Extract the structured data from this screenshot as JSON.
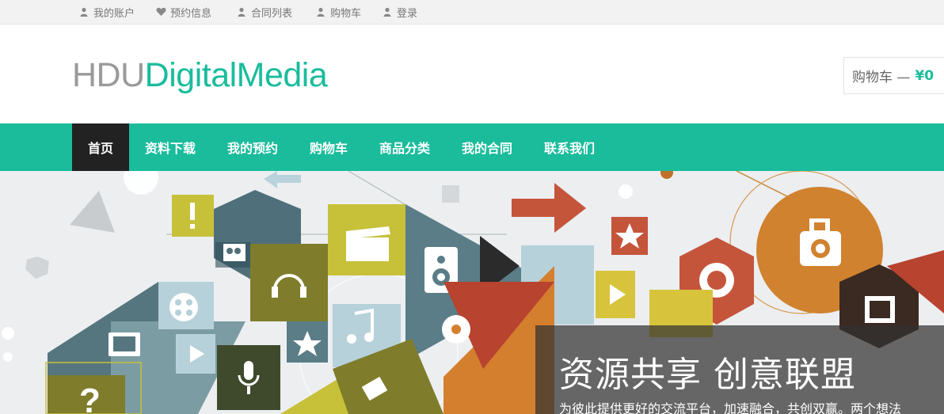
{
  "topbar": {
    "items": [
      {
        "label": "我的账户",
        "icon": "user-icon"
      },
      {
        "label": "预约信息",
        "icon": "heart-icon"
      },
      {
        "label": "合同列表",
        "icon": "user-icon"
      },
      {
        "label": "购物车",
        "icon": "user-icon"
      },
      {
        "label": "登录",
        "icon": "user-icon"
      }
    ]
  },
  "header": {
    "logo_part1": "HDU",
    "logo_part2": "DigitalMedia",
    "cart_label": "购物车 —",
    "cart_price": "¥0"
  },
  "nav": {
    "tabs": [
      {
        "label": "首页",
        "active": true
      },
      {
        "label": "资料下载"
      },
      {
        "label": "我的预约"
      },
      {
        "label": "购物车"
      },
      {
        "label": "商品分类"
      },
      {
        "label": "我的合同"
      },
      {
        "label": "联系我们"
      }
    ]
  },
  "banner": {
    "headline": "资源共享 创意联盟",
    "subtitle": "为彼此提供更好的交流平台，加速融合，共创双赢。两个想法"
  },
  "colors": {
    "accent": "#1abc9c",
    "nav_active": "#222222",
    "logo_gray": "#9a9a9a"
  }
}
